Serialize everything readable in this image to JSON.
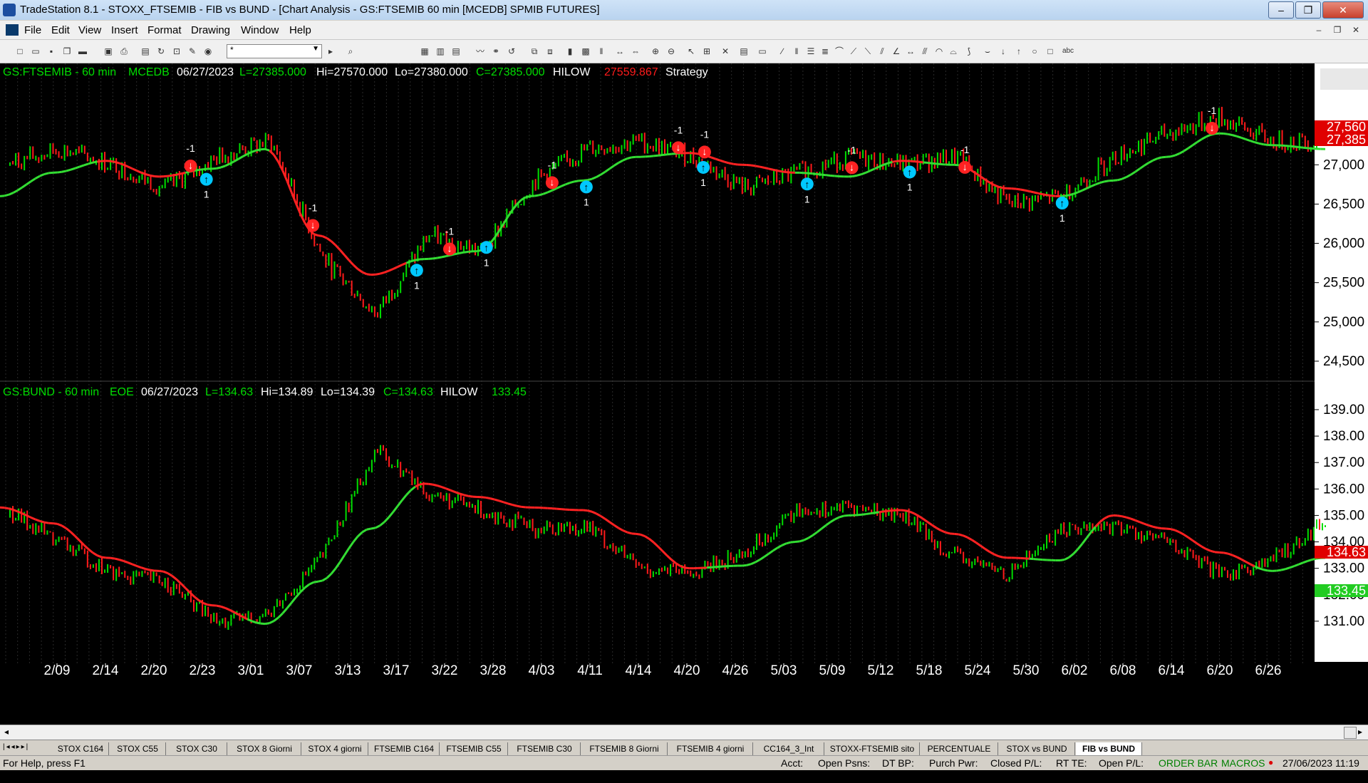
{
  "window": {
    "title": "TradeStation 8.1 - STOXX_FTSEMIB - FIB vs BUND - [Chart Analysis - GS:FTSEMIB  60 min  [MCEDB] SPMIB FUTURES]",
    "controls": [
      "–",
      "❐",
      "✕"
    ]
  },
  "menu": [
    "File",
    "Edit",
    "View",
    "Insert",
    "Format",
    "Drawing",
    "Window",
    "Help"
  ],
  "mdi_controls": [
    "–",
    "❐",
    "✕"
  ],
  "toolbar": {
    "combo_value": "*"
  },
  "colors": {
    "bg": "#000000",
    "up": "#00dd00",
    "down": "#ff1a1a",
    "hilow_up": "#33dd33",
    "hilow_down": "#ff2222",
    "grid": "#2a2a2a",
    "arrow_up": "#00c8ff",
    "arrow_down": "#ff2222",
    "text": "#ffffff"
  },
  "panel1": {
    "symbol": "GS:FTSEMIB - 60 min",
    "exchange": "MCEDB",
    "date": "06/27/2023",
    "last": "L=27385.000",
    "high": "Hi=27570.000",
    "low": "Lo=27380.000",
    "close": "C=27385.000",
    "indicator": "HILOW",
    "indicator_value": "27559.867",
    "strategy": "Strategy",
    "price_box_red1": "27,560",
    "price_box_red2": "27,385"
  },
  "panel2": {
    "symbol": "GS:BUND - 60 min",
    "exchange": "EOE",
    "date": "06/27/2023",
    "last": "L=134.63",
    "high": "Hi=134.89",
    "low": "Lo=134.39",
    "close": "C=134.63",
    "indicator": "HILOW",
    "indicator_value": "133.45",
    "price_box_red": "134.63",
    "price_box_green": "133.45"
  },
  "chart_data": [
    {
      "type": "line",
      "title": "GS:FTSEMIB - 60 min",
      "x": [
        "2/09",
        "2/14",
        "2/20",
        "2/23",
        "3/01",
        "3/07",
        "3/13",
        "3/17",
        "3/22",
        "3/28",
        "4/03",
        "4/11",
        "4/14",
        "4/20",
        "4/26",
        "5/03",
        "5/09",
        "5/12",
        "5/18",
        "5/24",
        "5/30",
        "6/02",
        "6/08",
        "6/14",
        "6/20",
        "6/26"
      ],
      "series": [
        {
          "values": [
            27000,
            27200,
            27000,
            26700,
            27100,
            27300,
            25800,
            25100,
            26100,
            25900,
            26800,
            27200,
            27300,
            27100,
            26700,
            26900,
            27100,
            27000,
            27100,
            26500,
            26600,
            27100,
            27400,
            27600,
            27300,
            27300
          ]
        },
        {
          "values": [
            26600,
            26900,
            27050,
            26850,
            26950,
            27200,
            26100,
            25600,
            25800,
            25900,
            26600,
            26800,
            27100,
            27150,
            27000,
            26900,
            26850,
            27050,
            27000,
            26700,
            26600,
            26800,
            27100,
            27400,
            27250,
            27200
          ]
        }
      ],
      "yticks": [
        "27,000",
        "26,500",
        "26,000",
        "25,500",
        "25,000",
        "24,500"
      ],
      "ylim": [
        24300,
        28200
      ]
    },
    {
      "type": "line",
      "title": "GS:BUND - 60 min",
      "x": [
        "2/09",
        "2/14",
        "2/20",
        "2/23",
        "3/01",
        "3/07",
        "3/13",
        "3/17",
        "3/22",
        "3/28",
        "4/03",
        "4/11",
        "4/14",
        "4/20",
        "4/26",
        "5/03",
        "5/09",
        "5/12",
        "5/18",
        "5/24",
        "5/30",
        "6/02",
        "6/08",
        "6/14",
        "6/20",
        "6/26"
      ],
      "series": [
        {
          "values": [
            135.2,
            134.0,
            132.8,
            132.5,
            130.9,
            131.3,
            133.5,
            137.5,
            135.8,
            135.2,
            134.5,
            134.6,
            133.0,
            132.8,
            133.6,
            135.2,
            135.3,
            135.0,
            133.4,
            132.8,
            134.5,
            134.6,
            134.0,
            132.7,
            133.3,
            134.8
          ]
        },
        {
          "values": [
            135.3,
            134.7,
            133.4,
            132.9,
            131.6,
            130.9,
            132.5,
            134.5,
            136.2,
            135.7,
            135.3,
            135.2,
            134.3,
            133.0,
            133.1,
            134.0,
            135.0,
            135.2,
            134.3,
            133.4,
            133.3,
            135.0,
            134.5,
            133.6,
            132.9,
            133.4
          ]
        }
      ],
      "yticks": [
        "139.00",
        "138.00",
        "137.00",
        "136.00",
        "135.00",
        "134.00",
        "133.00",
        "132.00",
        "131.00"
      ],
      "ylim": [
        130.0,
        139.7
      ]
    }
  ],
  "xaxis_labels": [
    "2/09",
    "2/14",
    "2/20",
    "2/23",
    "3/01",
    "3/07",
    "3/13",
    "3/17",
    "3/22",
    "3/28",
    "4/03",
    "4/11",
    "4/14",
    "4/20",
    "4/26",
    "5/03",
    "5/09",
    "5/12",
    "5/18",
    "5/24",
    "5/30",
    "6/02",
    "6/08",
    "6/14",
    "6/20",
    "6/26"
  ],
  "signals": [
    {
      "x": 0.145,
      "dir": "down",
      "label": "-1"
    },
    {
      "x": 0.157,
      "dir": "up",
      "label": "1"
    },
    {
      "x": 0.238,
      "dir": "down",
      "label": "-1"
    },
    {
      "x": 0.317,
      "dir": "up",
      "label": "1"
    },
    {
      "x": 0.342,
      "dir": "down",
      "label": "-1"
    },
    {
      "x": 0.37,
      "dir": "up",
      "label": "1"
    },
    {
      "x": 0.42,
      "dir": "down",
      "label": "-1"
    },
    {
      "x": 0.446,
      "dir": "up",
      "label": "1"
    },
    {
      "x": 0.516,
      "dir": "down",
      "label": "-1"
    },
    {
      "x": 0.536,
      "dir": "down",
      "label": "-1"
    },
    {
      "x": 0.535,
      "dir": "up",
      "label": "1"
    },
    {
      "x": 0.614,
      "dir": "up",
      "label": "1"
    },
    {
      "x": 0.648,
      "dir": "down",
      "label": "-1"
    },
    {
      "x": 0.692,
      "dir": "up",
      "label": "1"
    },
    {
      "x": 0.734,
      "dir": "down",
      "label": "-1"
    },
    {
      "x": 0.808,
      "dir": "up",
      "label": "1"
    },
    {
      "x": 0.922,
      "dir": "down",
      "label": "-1"
    }
  ],
  "tabs": [
    "STOX C164",
    "STOX C55",
    "STOX  C30",
    "STOX  8 Giorni",
    "STOX 4 giorni",
    "FTSEMIB C164",
    "FTSEMIB C55",
    "FTSEMIB C30",
    "FTSEMIB  8 Giorni",
    "FTSEMIB  4 giorni",
    "CC164_3_Int",
    "STOXX-FTSEMIB sito",
    "PERCENTUALE",
    "STOX vs BUND",
    "FIB vs BUND"
  ],
  "active_tab": 14,
  "status": {
    "help": "For Help, press F1",
    "acct": "Acct:",
    "open_psns": "Open Psns:",
    "dt_bp": "DT BP:",
    "purch_pwr": "Purch Pwr:",
    "closed_pl": "Closed P/L:",
    "rt_te": "RT TE:",
    "open_pl": "Open P/L:",
    "order_bar": "ORDER BAR",
    "macros": "MACROS",
    "datetime": "27/06/2023 11:19"
  }
}
